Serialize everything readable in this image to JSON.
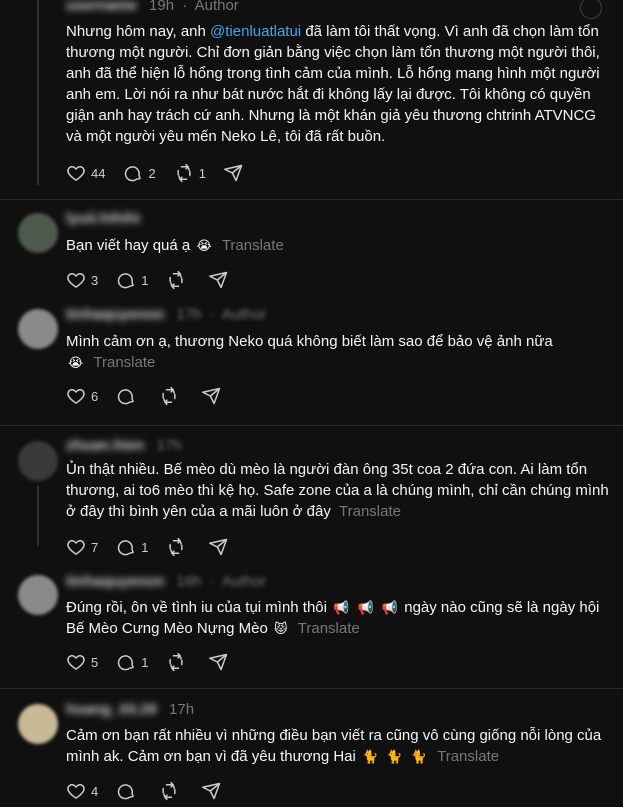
{
  "top": {
    "username": "username",
    "time": "19h",
    "author_tag": "Author"
  },
  "main_post": {
    "text_before_mention": "Nhưng hôm nay, anh ",
    "mention": "@tienluatlatui",
    "text_after_mention": " đã làm tôi thất vọng. Vì anh đã chọn làm tổn thương một người. Chỉ đơn giản bằng việc chọn làm tổn thương một người thôi, anh đã thể hiện lỗ hổng trong tình cảm của mình. Lỗ hổng mang hình một người anh em. Lời nói ra như bát nước hắt đi không lấy lại được. Tôi không có quyền giận anh hay trách cứ anh. Nhưng là một khán giả yêu thương chtrinh ATVNCG và một người yêu mến Neko Lê, tôi đã rất buồn.",
    "likes": "44",
    "replies": "2",
    "reposts": "1"
  },
  "comments": [
    {
      "username": "lyuii.hihihi",
      "time": "",
      "author_tag": "",
      "text": "Bạn viết hay quá ạ",
      "emojis": [
        "😭"
      ],
      "translate": "Translate",
      "likes": "3",
      "replies": "1",
      "reposts": ""
    },
    {
      "username": "tinhaquyenon",
      "time": "17h",
      "author_tag": "Author",
      "text": "Mình cảm ơn ạ, thương Neko quá không biết làm sao để bảo vệ ảnh nữa",
      "emojis": [
        "😭"
      ],
      "translate": "Translate",
      "likes": "6",
      "replies": "",
      "reposts": ""
    },
    {
      "username": "zhuan.hien",
      "time": "17h",
      "author_tag": "",
      "text": "Ủn thật nhiều. Bế mèo dù mèo là người đàn ông 35t coa 2 đứa con. Ai làm tổn thương, ai to6 mèo thì kệ họ. Safe zone của a là chúng mình, chỉ cần chúng mình ở đây thì bình yên của a mãi luôn ở đây",
      "emojis": [],
      "translate": "Translate",
      "likes": "7",
      "replies": "1",
      "reposts": ""
    },
    {
      "username": "tinhaquyenon",
      "time": "16h",
      "author_tag": "Author",
      "text": "Đúng rồi, ôn về tình iu của tụi mình thôi",
      "emojis": [
        "📢",
        "📢",
        "📢"
      ],
      "text2": "ngày nào cũng sẽ là ngày hội Bế Mèo Cưng Mèo Nựng Mèo",
      "emojis2": [
        "😾"
      ],
      "translate": "Translate",
      "likes": "5",
      "replies": "1",
      "reposts": ""
    },
    {
      "username": "hoang_03.29",
      "time": "17h",
      "author_tag": "",
      "text": "Cảm ơn bạn rất nhiều vì những điều bạn viết ra cũng vô cùng giống nỗi lòng của mình ak. Cảm ơn bạn vì đã yêu thương Hai",
      "emojis": [
        "🐈",
        "🐈",
        "🐈"
      ],
      "translate": "Translate",
      "likes": "4",
      "replies": "",
      "reposts": ""
    }
  ],
  "colors": {
    "background": "#101010",
    "text": "#f3f5f7",
    "muted": "#777777",
    "mention": "#4aa3e8",
    "divider": "#2a2a2a"
  },
  "icons": [
    "heart-icon",
    "comment-icon",
    "repost-icon",
    "share-icon",
    "more-icon"
  ]
}
